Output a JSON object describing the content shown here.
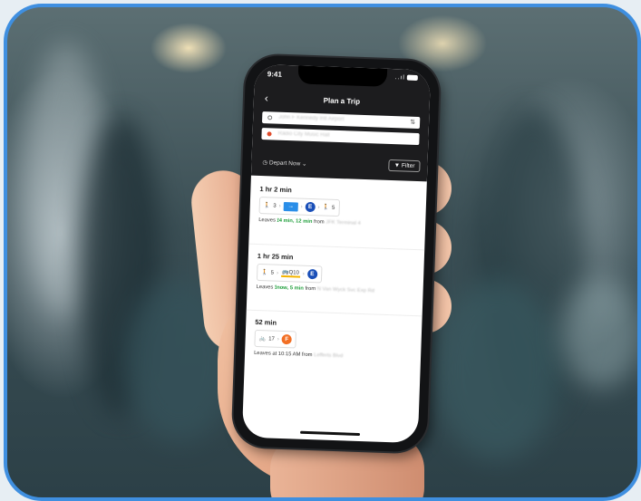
{
  "status_bar": {
    "time": "9:41",
    "signal": "..ıl"
  },
  "header": {
    "back_icon": "chevron-left-icon",
    "title": "Plan a Trip"
  },
  "search": {
    "origin_placeholder": "John F Kennedy Intl Airport",
    "destination_placeholder": "Radio City Music Hall",
    "swap_icon": "⇅"
  },
  "options": {
    "depart_label": "Depart Now",
    "filter_label": "Filter"
  },
  "colors": {
    "dark": "#1c1c1e",
    "subway_blue": "#1a4fb8",
    "subway_orange": "#f26f24",
    "realtime_green": "#1e9e3a",
    "frame_blue": "#3f8fe0"
  },
  "trips": [
    {
      "duration": "1 hr 2 min",
      "walk1": "3",
      "line": "E",
      "walk2": "5",
      "leaves_prefix": "Leaves",
      "times": "4 min, 12 min",
      "from_label": "from",
      "station": "JFK Terminal 4"
    },
    {
      "duration": "1 hr 25 min",
      "walk1": "5",
      "bus": "Q10",
      "line": "E",
      "leaves_prefix": "Leaves",
      "times": "now, 5 min",
      "from_label": "from",
      "station": "N Van Wyck Svc Exp Rd"
    },
    {
      "duration": "52 min",
      "bike": "17",
      "line": "F",
      "leaves_prefix": "Leaves at 10:15 AM",
      "from_label": "from",
      "station": "Lefferts Blvd"
    }
  ]
}
